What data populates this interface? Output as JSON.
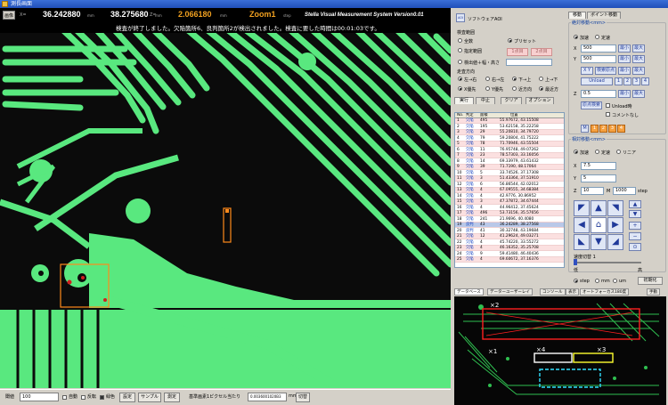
{
  "window": {
    "title": "測長画面"
  },
  "status": {
    "button": "画像",
    "x_label": "X=",
    "x_value": "36.242880",
    "x_unit": "mm",
    "y_label": "Y=",
    "y_value": "38.275680",
    "y_unit": "mm",
    "z_label": "Z=",
    "z_value": "2.066180",
    "z_unit": "mm",
    "zoom_label": "Zoom1",
    "zoom_unit": "step",
    "app_title": "Stella Visual Measurement System Version0.01",
    "message": "検査が終了しました。欠陥箇所6、良判箇所2が検出されました。検査に要した時間は00:01:03です。"
  },
  "bottom": {
    "threshold_label": "閾値",
    "threshold_value": "100",
    "auto_label": "自動",
    "invert_label": "反転",
    "color_label": "緑色",
    "set_btn": "設定",
    "sample_btn": "サンプル",
    "measure_btn": "測定",
    "pixel_label": "基準画素1ピクセル当たり",
    "pixel_value": "0.0036001020B3",
    "pixel_unit": "mm",
    "switch_btn": "切替"
  },
  "mid": {
    "aoi_badge": "AOI",
    "aoi_title": "ソフトウェアAOI",
    "scope_label": "検査範囲",
    "opt_all": "全数",
    "opt_preset": "プリセット",
    "opt_specify": "指定範囲",
    "opt_width": "検出値＋幅・高さ",
    "preset_a": "1点目",
    "preset_b": "2点目",
    "dir_label": "走査方向",
    "dir_1": "左→右",
    "dir_2": "右→左",
    "dir_3": "下→上",
    "dir_4": "上→下",
    "dir_5": "X優先",
    "dir_6": "Y優先",
    "dir_7": "近方向",
    "dir_8": "最近方",
    "tab_exec": "実行",
    "tab_mid": "中止",
    "tab_clear": "クリア",
    "tab_option": "オプション",
    "col_no": "No.",
    "col_judge": "判定",
    "col_area": "面積",
    "col_pos": "位置"
  },
  "rows": [
    {
      "no": "1",
      "j": "欠陥",
      "a": "495",
      "p": "55.97672, 43.15508"
    },
    {
      "no": "2",
      "j": "欠陥",
      "a": "195",
      "p": "53.62158, 35.22258"
    },
    {
      "no": "3",
      "j": "欠陥",
      "a": "29",
      "p": "55.20810, 34.79720"
    },
    {
      "no": "4",
      "j": "欠陥",
      "a": "79",
      "p": "59.20804, 41.75222"
    },
    {
      "no": "5",
      "j": "欠陥",
      "a": "78",
      "p": "71.70946, 43.55504"
    },
    {
      "no": "6",
      "j": "欠陥",
      "a": "11",
      "p": "76.95748, 49.07262"
    },
    {
      "no": "7",
      "j": "欠陥",
      "a": "23",
      "p": "78.57303, 33.16056"
    },
    {
      "no": "8",
      "j": "欠陥",
      "a": "14",
      "p": "69.33979, 43.61432"
    },
    {
      "no": "9",
      "j": "欠陥",
      "a": "39",
      "p": "71.7190, 48.17064"
    },
    {
      "no": "10",
      "j": "欠陥",
      "a": "5",
      "p": "33.74526, 37.17308"
    },
    {
      "no": "11",
      "j": "欠陥",
      "a": "3",
      "p": "51.43364, 37.51910"
    },
    {
      "no": "12",
      "j": "欠陥",
      "a": "6",
      "p": "56.86544, 42.02012"
    },
    {
      "no": "13",
      "j": "欠陥",
      "a": "4",
      "p": "67.09555, 34.68384"
    },
    {
      "no": "14",
      "j": "欠陥",
      "a": "4",
      "p": "42.9776, 30.86952"
    },
    {
      "no": "15",
      "j": "欠陥",
      "a": "3",
      "p": "47.37872, 34.67444"
    },
    {
      "no": "16",
      "j": "欠陥",
      "a": "4",
      "p": "44.96412, 37.45624"
    },
    {
      "no": "17",
      "j": "欠陥",
      "a": "496",
      "p": "53.73156, 35.57656"
    },
    {
      "no": "18",
      "j": "欠陥",
      "a": "241",
      "p": "21.9696, 40.4080"
    },
    {
      "no": "19",
      "j": "良判",
      "a": "43",
      "p": "36.24289, 38.27568"
    },
    {
      "no": "20",
      "j": "良判",
      "a": "41",
      "p": "30.32748, 43.19684"
    },
    {
      "no": "21",
      "j": "欠陥",
      "a": "12",
      "p": "41.29624, 49.03271"
    },
    {
      "no": "22",
      "j": "欠陥",
      "a": "4",
      "p": "45.74220, 33.55272"
    },
    {
      "no": "23",
      "j": "欠陥",
      "a": "4",
      "p": "46.16352, 35.25708"
    },
    {
      "no": "24",
      "j": "欠陥",
      "a": "9",
      "p": "59.41480, 46.40436"
    },
    {
      "no": "25",
      "j": "欠陥",
      "a": "4",
      "p": "69.60672, 37.16376"
    }
  ],
  "right": {
    "tab_move": "移動",
    "tab_point": "ポイント移動",
    "abs_title": "絶対移動<mm>",
    "mode_accel": "加速",
    "mode_const": "定速",
    "x_label": "X",
    "x_value": "500",
    "y_label": "Y",
    "y_value": "500",
    "btn_min": "最小",
    "btn_max": "最大",
    "btn_xy": "X Y",
    "btn_home": "検索原点",
    "btn_unload": "Unload",
    "btn_1": "1",
    "btn_2": "2",
    "btn_3": "3",
    "btn_4": "4",
    "z_label": "Z",
    "z_value": "0.5",
    "btn_z_home": "原点検索",
    "unload_label": "Unload時",
    "mem_label": "コメントなし",
    "m_label": "M",
    "rel_title": "相対移動<mm>",
    "mode_linear": "リニア",
    "rel_x": "7.5",
    "rel_y": "5",
    "rel_z": "10",
    "m_prefix": "M",
    "m_value": "1000",
    "step_label": "step",
    "speed_label": "速度切替 1",
    "speed_min": "低",
    "speed_max": "高",
    "unit_step": "step",
    "unit_mm": "mm",
    "unit_um": "um",
    "init_btn": "初期化"
  },
  "layout_tabs": [
    "データベース",
    "データーユーザーレイ",
    "コンソール",
    "表示",
    "オートフォーカス180度",
    "手動"
  ],
  "layout_marks": [
    "×2",
    "×1",
    "×4",
    "×3"
  ],
  "colors": {
    "board_green": "#59e87f",
    "highlight_orange": "#ff8a1c",
    "dark": "#0b0b0b"
  }
}
